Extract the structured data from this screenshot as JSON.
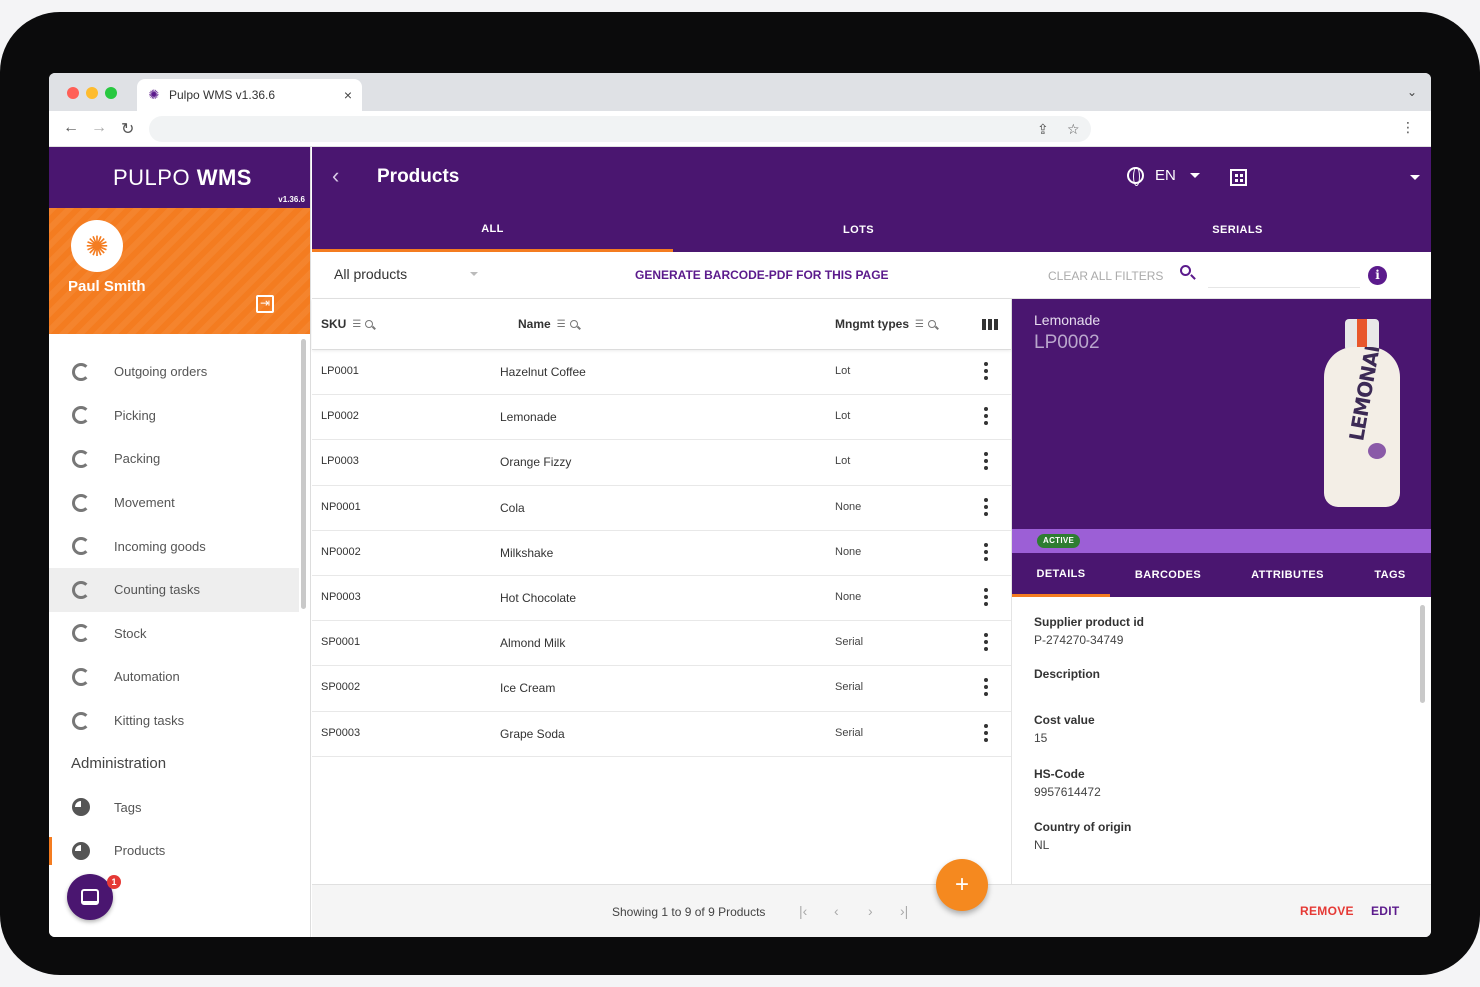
{
  "browser": {
    "tab_title": "Pulpo WMS v1.36.6",
    "tab_close": "×",
    "url": ""
  },
  "brand": {
    "logo_light": "PULPO",
    "logo_bold": "WMS",
    "version": "v1.36.6"
  },
  "user": {
    "name": "Paul Smith"
  },
  "sidebar": {
    "items": [
      {
        "label": "Outgoing orders"
      },
      {
        "label": "Picking"
      },
      {
        "label": "Packing"
      },
      {
        "label": "Movement"
      },
      {
        "label": "Incoming goods"
      },
      {
        "label": "Counting tasks"
      },
      {
        "label": "Stock"
      },
      {
        "label": "Automation"
      },
      {
        "label": "Kitting tasks"
      }
    ],
    "section_admin": "Administration",
    "admin_items": [
      {
        "label": "Tags"
      },
      {
        "label": "Products"
      }
    ],
    "chat_badge": "1"
  },
  "header": {
    "title": "Products",
    "language": "EN"
  },
  "tabs": {
    "all": "ALL",
    "lots": "LOTS",
    "serials": "SERIALS"
  },
  "filters": {
    "select_value": "All products",
    "generate_pdf": "GENERATE BARCODE-PDF FOR THIS PAGE",
    "clear_all": "CLEAR ALL FILTERS",
    "search_value": "",
    "info": "i"
  },
  "table": {
    "columns": {
      "sku": "SKU",
      "name": "Name",
      "mgmt": "Mngmt types"
    },
    "rows": [
      {
        "sku": "LP0001",
        "name": "Hazelnut Coffee",
        "mgmt": "Lot"
      },
      {
        "sku": "LP0002",
        "name": "Lemonade",
        "mgmt": "Lot"
      },
      {
        "sku": "LP0003",
        "name": "Orange Fizzy",
        "mgmt": "Lot"
      },
      {
        "sku": "NP0001",
        "name": "Cola",
        "mgmt": "None"
      },
      {
        "sku": "NP0002",
        "name": "Milkshake",
        "mgmt": "None"
      },
      {
        "sku": "NP0003",
        "name": "Hot Chocolate",
        "mgmt": "None"
      },
      {
        "sku": "SP0001",
        "name": "Almond Milk",
        "mgmt": "Serial"
      },
      {
        "sku": "SP0002",
        "name": "Ice Cream",
        "mgmt": "Serial"
      },
      {
        "sku": "SP0003",
        "name": "Grape Soda",
        "mgmt": "Serial"
      }
    ]
  },
  "detail": {
    "name": "Lemonade",
    "sku": "LP0002",
    "bottle_label": "LEMONADE",
    "status": "ACTIVE",
    "tabs": {
      "details": "DETAILS",
      "barcodes": "BARCODES",
      "attributes": "ATTRIBUTES",
      "tags": "TAGS"
    },
    "fields": {
      "supplier_label": "Supplier product id",
      "supplier_value": "P-274270-34749",
      "description_label": "Description",
      "description_value": "",
      "cost_label": "Cost value",
      "cost_value": "15",
      "hs_label": "HS-Code",
      "hs_value": "9957614472",
      "origin_label": "Country of origin",
      "origin_value": "NL"
    }
  },
  "footer": {
    "showing": "Showing 1 to 9 of 9 Products",
    "remove": "REMOVE",
    "edit": "EDIT",
    "fab": "+"
  },
  "colors": {
    "brand_purple": "#4a1670",
    "accent_orange": "#f47c20",
    "status_green": "#2e7d32",
    "danger_red": "#e53935"
  }
}
